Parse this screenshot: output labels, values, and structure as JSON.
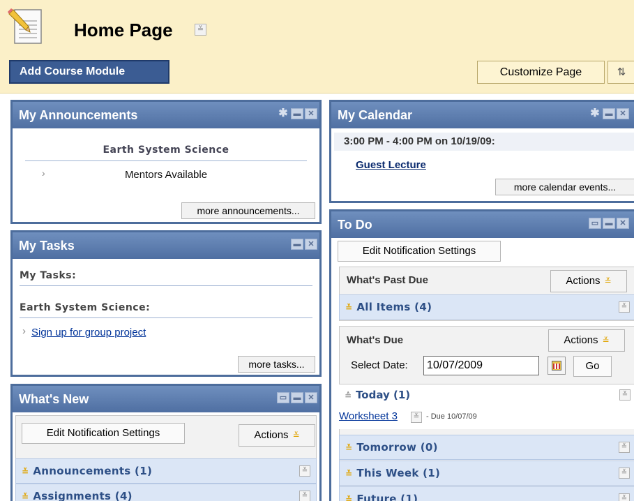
{
  "header": {
    "title": "Home Page",
    "add_module_label": "Add Course Module",
    "customize_label": "Customize Page",
    "reorder_glyph": "⇅"
  },
  "announcements": {
    "title": "My Announcements",
    "course": "Earth System Science",
    "items": [
      "Mentors Available"
    ],
    "more": "more announcements..."
  },
  "tasks": {
    "title": "My Tasks",
    "my_tasks_label": "My Tasks:",
    "course_label": "Earth System Science:",
    "items": [
      "Sign up for group project"
    ],
    "more": "more tasks..."
  },
  "whats_new": {
    "title": "What's New",
    "edit_label": "Edit Notification Settings",
    "actions_label": "Actions",
    "rows": [
      "Announcements (1)",
      "Assignments (4)"
    ]
  },
  "calendar": {
    "title": "My Calendar",
    "event_time": "3:00 PM - 4:00 PM on 10/19/09:",
    "event_name": "Guest Lecture",
    "more": "more calendar events..."
  },
  "todo": {
    "title": "To Do",
    "edit_label": "Edit Notification Settings",
    "past_due": {
      "heading": "What's Past Due",
      "actions_label": "Actions",
      "row": "All Items (4)"
    },
    "due": {
      "heading": "What's Due",
      "actions_label": "Actions",
      "select_date_label": "Select Date:",
      "date_value": "10/07/2009",
      "go_label": "Go",
      "today_label": "Today (1)",
      "today_item": "Worksheet 3",
      "today_item_due": "- Due 10/07/09",
      "rows": [
        "Tomorrow (0)",
        "This Week (1)",
        "Future (1)"
      ]
    }
  },
  "colors": {
    "header_bg": "#fbf0c8",
    "module_header": "#4f6fa2",
    "module_border": "#4d6d9c",
    "bar_bg": "#dbe6f6",
    "accent_chevron": "#e0a400"
  }
}
